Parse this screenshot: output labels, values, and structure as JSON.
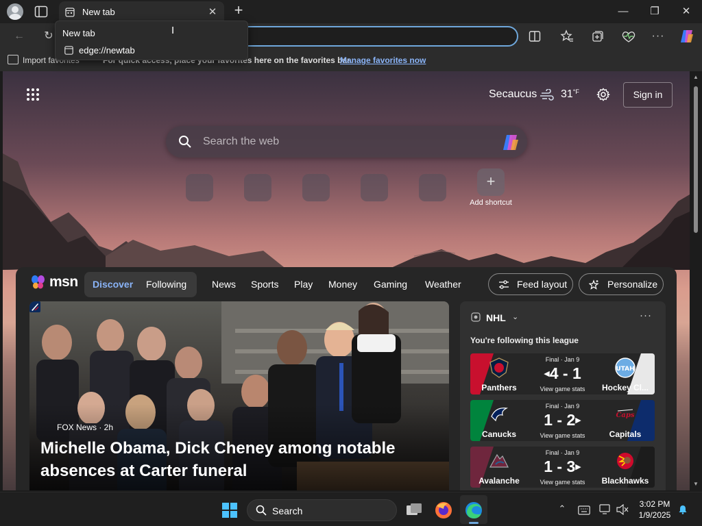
{
  "browser": {
    "tab": {
      "title": "New tab"
    },
    "dropdown": {
      "title": "New tab",
      "url": "edge://newtab"
    },
    "favorites_bar": {
      "import_label": "Import favorites",
      "hint": "For quick access, place your favorites here on the favorites bar.",
      "manage_link": "Manage favorites now"
    }
  },
  "newtab": {
    "weather": {
      "location": "Secaucus",
      "temperature": "31",
      "unit": "°F"
    },
    "signin_label": "Sign in",
    "search_placeholder": "Search the web",
    "add_shortcut_label": "Add shortcut"
  },
  "feed": {
    "brand": "msn",
    "tabs": [
      "Discover",
      "Following"
    ],
    "nav": [
      "News",
      "Sports",
      "Play",
      "Money",
      "Gaming",
      "Weather"
    ],
    "feed_layout_label": "Feed layout",
    "personalize_label": "Personalize",
    "hero": {
      "source": "FOX News · 2h",
      "headline": "Michelle Obama, Dick Cheney among notable absences at Carter funeral"
    },
    "nhl": {
      "title": "NHL",
      "subtitle": "You're following this league",
      "games": [
        {
          "status": "Final · Jan 9",
          "home": "Panthers",
          "away": "Hockey Cl...",
          "score": "4 - 1",
          "winner": "left",
          "stats": "View game stats",
          "left_color": "#c8102e",
          "right_color": "#e8e8e8"
        },
        {
          "status": "Final · Jan 9",
          "home": "Canucks",
          "away": "Capitals",
          "score": "1 - 2",
          "winner": "right",
          "stats": "View game stats",
          "left_color": "#00843d",
          "right_color": "#0d2c6c"
        },
        {
          "status": "Final · Jan 9",
          "home": "Avalanche",
          "away": "Blackhawks",
          "score": "1 - 3",
          "winner": "right",
          "stats": "View game stats",
          "left_color": "#6f263d",
          "right_color": "#1c1c1c"
        }
      ]
    }
  },
  "taskbar": {
    "search_label": "Search",
    "time": "3:02 PM",
    "date": "1/9/2025"
  },
  "colors": {
    "accent": "#8ab4f8",
    "address_border": "#6fa8dc"
  }
}
